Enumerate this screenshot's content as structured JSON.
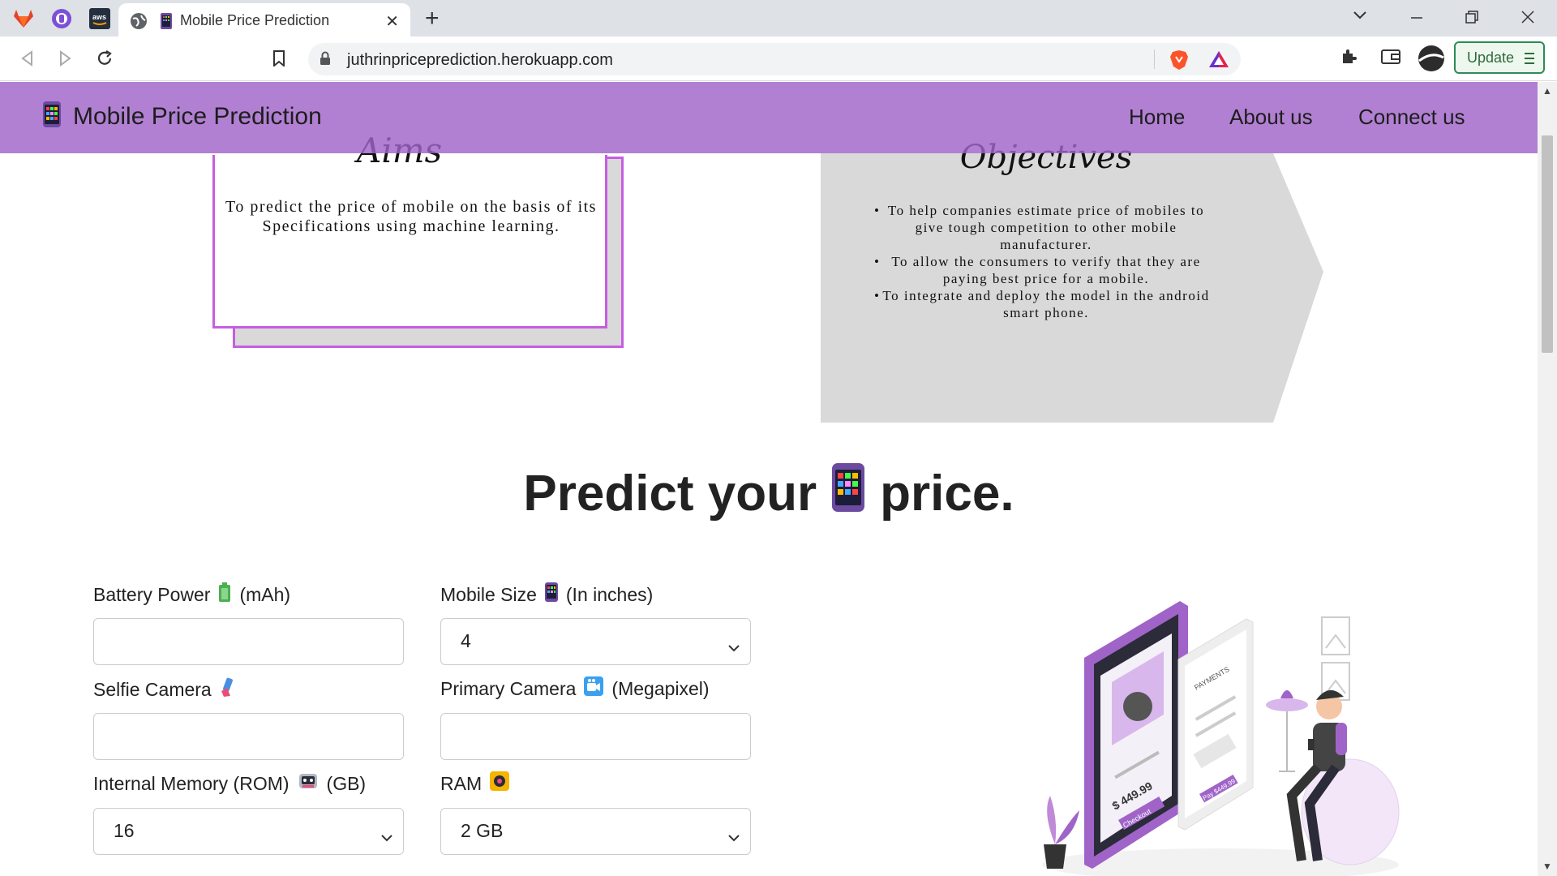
{
  "browser": {
    "pinned_tabs": [
      "gitlab-icon",
      "proton-vpn-icon",
      "aws-icon"
    ],
    "tab": {
      "title": "Mobile Price Prediction"
    },
    "url": "juthrinpriceprediction.herokuapp.com",
    "update_label": "Update"
  },
  "navbar": {
    "brand": "Mobile Price Prediction",
    "links": [
      "Home",
      "About us",
      "Connect us"
    ]
  },
  "aims": {
    "title": "Aims",
    "text": "To predict the price of mobile on the basis of its Specifications using machine learning."
  },
  "objectives": {
    "title": "Objectives",
    "items": [
      "To help companies estimate price of mobiles to give tough competition to other mobile manufacturer.",
      "To allow the consumers to verify that they are paying best price for a mobile.",
      "To integrate and deploy the model in the android smart phone."
    ]
  },
  "predict": {
    "title_before": "Predict your",
    "title_after": "price."
  },
  "form": {
    "battery_label": "Battery Power",
    "battery_unit": "(mAh)",
    "battery_value": "",
    "mobile_size_label": "Mobile Size",
    "mobile_size_unit": "(In inches)",
    "mobile_size_value": "4",
    "selfie_label": "Selfie Camera",
    "selfie_value": "",
    "primary_label": "Primary Camera",
    "primary_unit": "(Megapixel)",
    "primary_value": "",
    "rom_label": "Internal Memory (ROM)",
    "rom_unit": "(GB)",
    "rom_value": "16",
    "ram_label": "RAM",
    "ram_value": "2 GB"
  },
  "illustration": {
    "price_tag": "$ 449.99",
    "checkout": "Checkout",
    "payments": "PAYMENTS",
    "pay": "Pay $449.99"
  },
  "colors": {
    "navbar": "#a064c8",
    "accent": "#c65ee0",
    "arrow_fill": "#d9d9d9"
  }
}
